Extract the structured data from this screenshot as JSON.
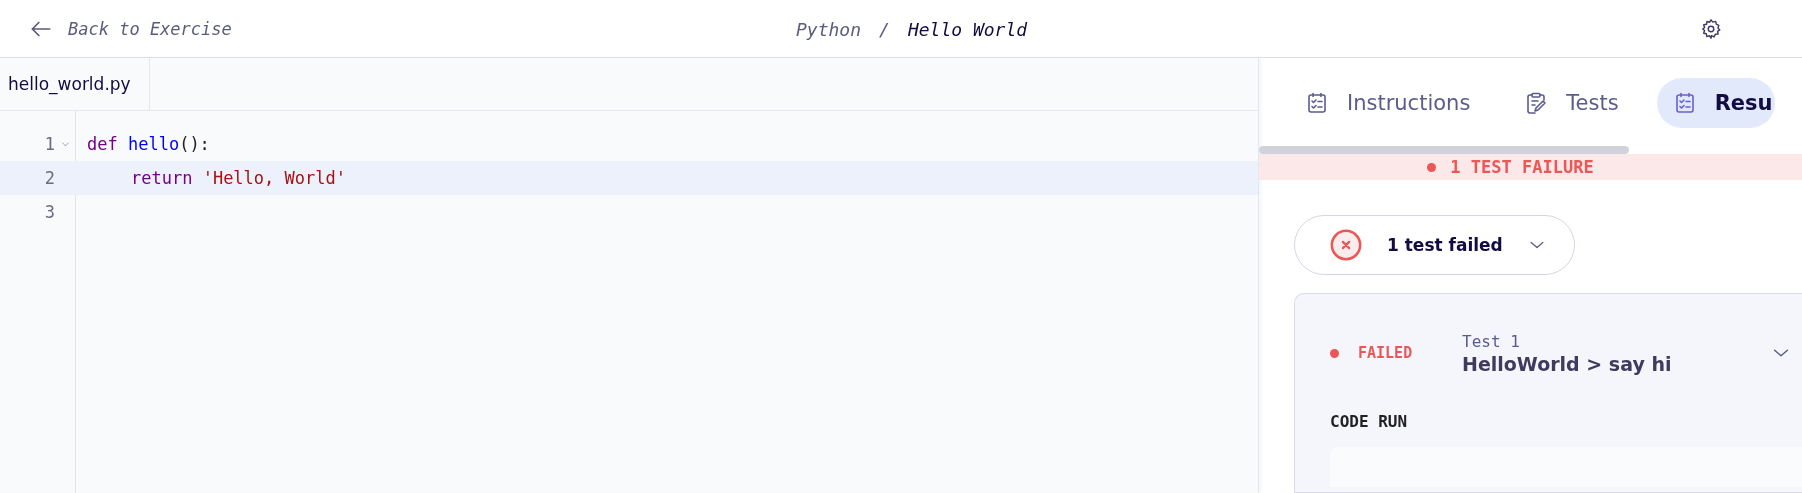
{
  "header": {
    "back_link": "Back to Exercise",
    "breadcrumb": [
      "Python",
      "Hello World"
    ],
    "separator": "/"
  },
  "editor": {
    "file_tab": "hello_world.py",
    "lines": [
      {
        "number": "1",
        "foldable": true,
        "active": false,
        "tokens": [
          {
            "kind": "keyword",
            "text": "def "
          },
          {
            "kind": "function",
            "text": "hello"
          },
          {
            "kind": "plain",
            "text": "():"
          }
        ]
      },
      {
        "number": "2",
        "foldable": false,
        "active": true,
        "indented": true,
        "tokens": [
          {
            "kind": "keyword",
            "text": "return "
          },
          {
            "kind": "string",
            "text": "'Hello, World'"
          }
        ]
      },
      {
        "number": "3",
        "foldable": false,
        "active": false
      }
    ]
  },
  "panel": {
    "tabs": [
      {
        "label": "Instructions",
        "selected": false
      },
      {
        "label": "Tests",
        "selected": false
      },
      {
        "label": "Resu",
        "selected": true
      }
    ],
    "banner": "1 TEST FAILURE",
    "summary_dropdown": "1 test failed",
    "test": {
      "status": "FAILED",
      "title": "Test 1",
      "name": "HelloWorld > say hi",
      "section": "CODE RUN",
      "expanded": true
    }
  }
}
